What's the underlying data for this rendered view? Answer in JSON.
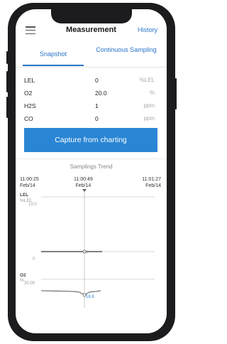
{
  "header": {
    "title": "Measurement",
    "history_label": "History"
  },
  "tabs": [
    {
      "label": "Snapshot",
      "active": true
    },
    {
      "label": "Continuous Sampling",
      "active": false
    }
  ],
  "gases": [
    {
      "name": "LEL",
      "value": "0",
      "unit": "%LEL"
    },
    {
      "name": "O2",
      "value": "20.0",
      "unit": "%"
    },
    {
      "name": "H2S",
      "value": "1",
      "unit": "ppm"
    },
    {
      "name": "CO",
      "value": "0",
      "unit": "ppm"
    }
  ],
  "capture_label": "Capture from charting",
  "trend": {
    "title": "Samplings Trend",
    "times": [
      {
        "time": "11:00:25",
        "date": "Feb/14"
      },
      {
        "time": "11:00:49",
        "date": "Feb/14"
      },
      {
        "time": "11:01:27",
        "date": "Feb/14"
      }
    ],
    "charts": [
      {
        "gas": "LEL",
        "unit": "%LEL",
        "ymax": "10.0",
        "ymin": "0",
        "cursor_value": "0"
      },
      {
        "gas": "O2",
        "unit": "%",
        "ymax": "30.00",
        "cursor_value": "18.8"
      }
    ]
  },
  "colors": {
    "accent": "#2a86d4",
    "link": "#2a73c9"
  }
}
